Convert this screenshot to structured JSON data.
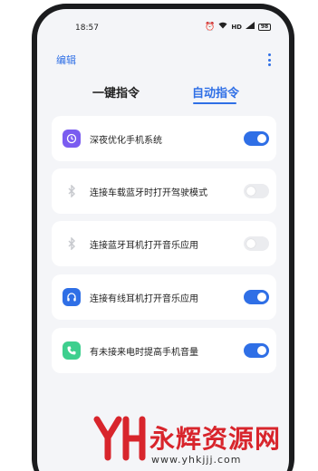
{
  "status_bar": {
    "time": "18:57",
    "network": "HD",
    "battery": "98"
  },
  "header": {
    "edit_label": "编辑"
  },
  "tabs": [
    {
      "label": "一键指令",
      "active": false
    },
    {
      "label": "自动指令",
      "active": true
    }
  ],
  "cards": [
    {
      "label": "深夜优化手机系统",
      "icon": "moon-clock-icon",
      "icon_color": "#7a5cf0",
      "enabled": true,
      "toggle": "on"
    },
    {
      "label": "连接车载蓝牙时打开驾驶模式",
      "icon": "bluetooth-icon",
      "icon_color": "#c7c9ce",
      "enabled": false,
      "toggle": "off"
    },
    {
      "label": "连接蓝牙耳机打开音乐应用",
      "icon": "bluetooth-icon",
      "icon_color": "#c7c9ce",
      "enabled": false,
      "toggle": "off"
    },
    {
      "label": "连接有线耳机打开音乐应用",
      "icon": "headphones-icon",
      "icon_color": "#2f6fe6",
      "enabled": true,
      "toggle": "on"
    },
    {
      "label": "有未接来电时提高手机音量",
      "icon": "phone-icon",
      "icon_color": "#3ecf8e",
      "enabled": true,
      "toggle": "on"
    }
  ],
  "watermark": {
    "logo_text": "YH",
    "title": "永辉资源网",
    "url": "www.yhkjjj.com"
  },
  "colors": {
    "accent": "#2f6fe6",
    "watermark_red": "#d8252c"
  }
}
